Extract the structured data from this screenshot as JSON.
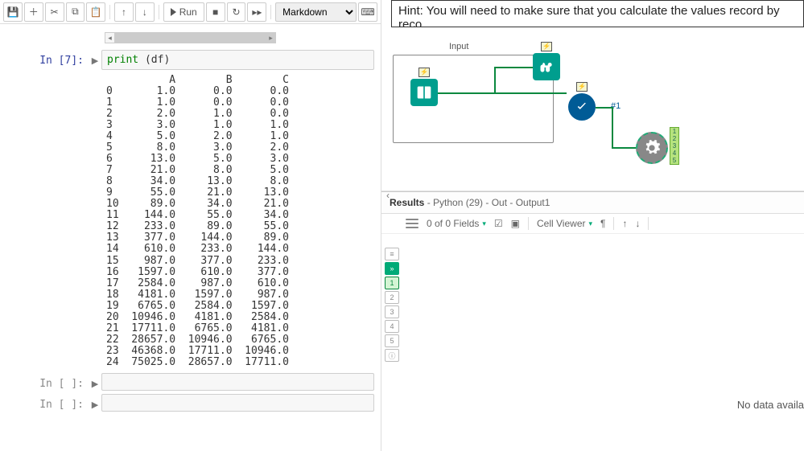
{
  "toolbar": {
    "run_label": "Run",
    "dropdown": "Markdown"
  },
  "notebook": {
    "cell1_prompt": "In [7]:",
    "cell1_code_prefix": "print",
    "cell1_code_suffix": " (df)",
    "empty_prompt": "In [ ]:",
    "df_header": "          A        B        C",
    "df_rows": [
      "0       1.0      0.0      0.0",
      "1       1.0      0.0      0.0",
      "2       2.0      1.0      0.0",
      "3       3.0      1.0      1.0",
      "4       5.0      2.0      1.0",
      "5       8.0      3.0      2.0",
      "6      13.0      5.0      3.0",
      "7      21.0      8.0      5.0",
      "8      34.0     13.0      8.0",
      "9      55.0     21.0     13.0",
      "10     89.0     34.0     21.0",
      "11    144.0     55.0     34.0",
      "12    233.0     89.0     55.0",
      "13    377.0    144.0     89.0",
      "14    610.0    233.0    144.0",
      "15    987.0    377.0    233.0",
      "16   1597.0    610.0    377.0",
      "17   2584.0    987.0    610.0",
      "18   4181.0   1597.0    987.0",
      "19   6765.0   2584.0   1597.0",
      "20  10946.0   4181.0   2584.0",
      "21  17711.0   6765.0   4181.0",
      "22  28657.0  10946.0   6765.0",
      "23  46368.0  17711.0  10946.0",
      "24  75025.0  28657.0  17711.0"
    ]
  },
  "right": {
    "hint": "Hint: You will need to make sure that you calculate the values record by reco",
    "canvas_label": "Input",
    "output_label": "#1",
    "results_prefix": "Results",
    "results_suffix": " - Python (29) - Out - Output1",
    "fields_text": "0 of 0 Fields",
    "cell_viewer": "Cell Viewer",
    "no_data": "No data availa",
    "node_badge": "1\n2\n3\n4\n5",
    "lightning": "⚡"
  }
}
